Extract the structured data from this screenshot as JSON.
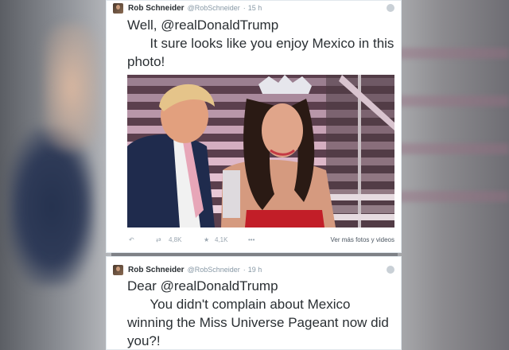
{
  "tweets": [
    {
      "author": "Rob Schneider",
      "handle": "@RobSchneider",
      "separator": "·",
      "time": "15 h",
      "line1": "Well, @realDonaldTrump",
      "line2": "      It sure looks like you enjoy Mexico in this",
      "line3": "photo!",
      "retweets": "4,8K",
      "favorites": "4,1K",
      "more_dots": "•••",
      "reply_icon": "reply-icon",
      "retweet_icon": "retweet-icon",
      "favorite_icon": "star-icon",
      "more_photos": "Ver más fotos y videos"
    },
    {
      "author": "Rob Schneider",
      "handle": "@RobSchneider",
      "separator": "·",
      "time": "19 h",
      "line1": "Dear @realDonaldTrump",
      "line2": "      You didn't complain about Mexico",
      "line3": "winning the Miss Universe Pageant now did",
      "line4": "you?!"
    }
  ],
  "colors": {
    "card_bg": "#ffffff",
    "text": "#2a2f33",
    "meta": "#8899a6",
    "backdrop": "#7e8186"
  }
}
